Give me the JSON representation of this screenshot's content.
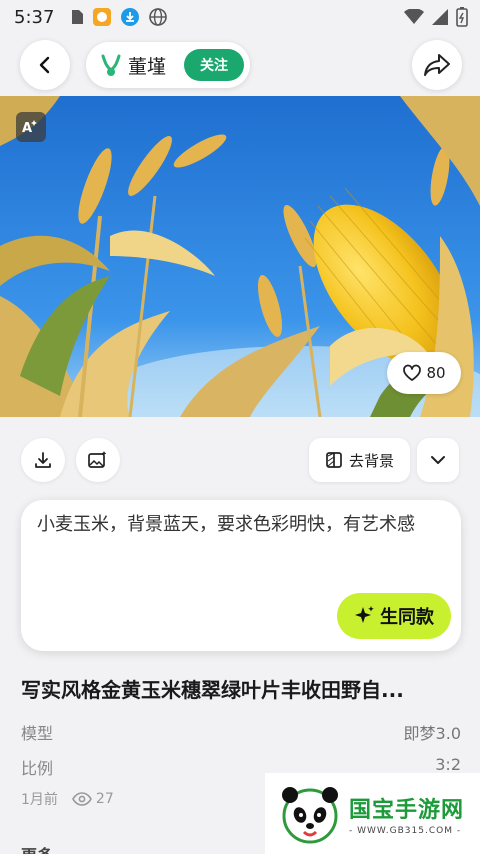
{
  "status_bar": {
    "time": "5:37",
    "icons": [
      "sim-icon",
      "app-notification-icon",
      "download-icon",
      "globe-icon",
      "wifi-icon",
      "signal-icon",
      "battery-icon"
    ]
  },
  "header": {
    "author_name": "董墐",
    "follow_label": "关注"
  },
  "hero": {
    "like_count": "80"
  },
  "actions": {
    "remove_bg_label": "去背景"
  },
  "prompt": {
    "text": "小麦玉米，背景蓝天，要求色彩明快，有艺术感",
    "generate_label": "生同款"
  },
  "work": {
    "title": "写实风格金黄玉米穗翠绿叶片丰收田野自...",
    "model_label": "模型",
    "model_value": "即梦3.0",
    "ratio_label": "比例",
    "ratio_value": "3:2",
    "time_ago": "1月前",
    "views": "27",
    "next_section": "更多"
  },
  "watermark": {
    "brand": "国宝手游网",
    "url": "- WWW.GB315.COM -"
  },
  "colors": {
    "accent_green": "#1aa86e",
    "generate_lime": "#c8f02f",
    "sky_blue": "#2f86e0"
  }
}
